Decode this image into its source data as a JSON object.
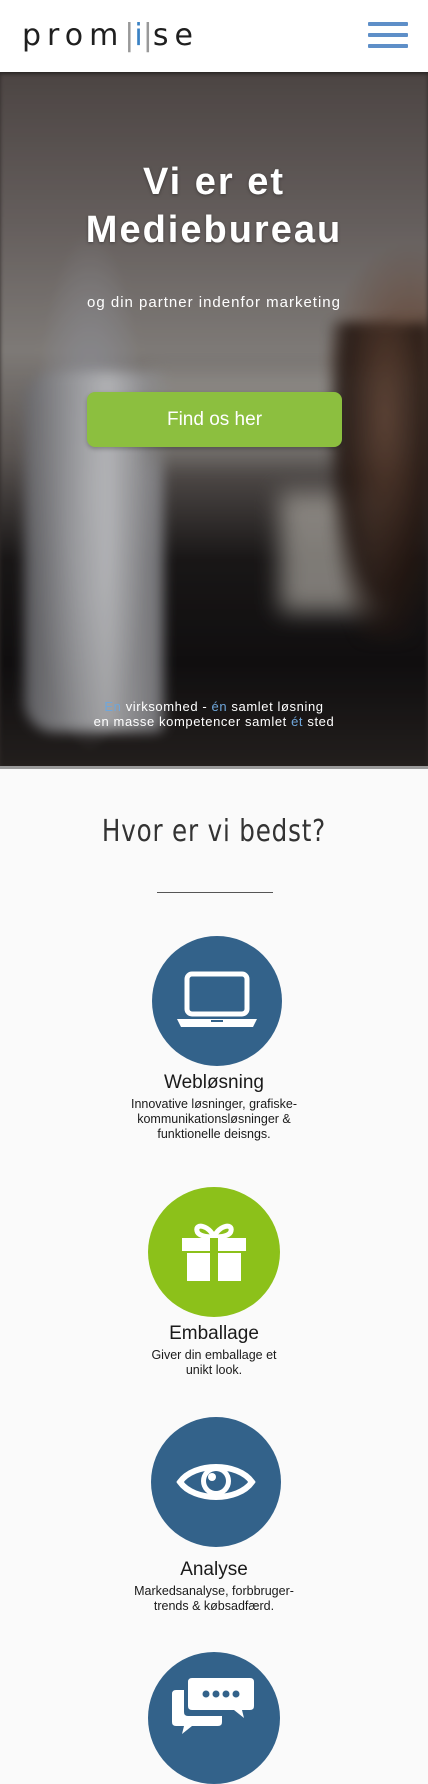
{
  "header": {
    "logo": {
      "part1": "prom",
      "bar1": "|",
      "i": "i",
      "bar2": "|",
      "part2": "se"
    },
    "menu_icon": "hamburger-menu-icon"
  },
  "hero": {
    "title_line1": "Vi er et",
    "title_line2": "Mediebureau",
    "subtitle": "og din partner indenfor marketing",
    "cta_label": "Find os her",
    "tagline": {
      "line1_a": "En",
      "line1_b": " virksomhed - ",
      "line1_c": "én",
      "line1_d": " samlet løsning",
      "line2_a": "en masse kompetencer samlet ",
      "line2_b": "ét",
      "line2_c": " sted"
    }
  },
  "section": {
    "title": "Hvor er vi bedst?"
  },
  "services": [
    {
      "name": "Webløsning",
      "desc_lines": [
        "Innovative løsninger, grafiske-",
        "kommunikationsløsninger &",
        "funktionelle deisngs."
      ],
      "icon": "laptop-icon",
      "color": "#33628a"
    },
    {
      "name": "Emballage",
      "desc_lines": [
        "Giver din emballage et",
        "unikt look."
      ],
      "icon": "gift-icon",
      "color": "#8cc11a"
    },
    {
      "name": "Analyse",
      "desc_lines": [
        "Markedsanalyse, forbbruger-",
        "trends & købsadfærd."
      ],
      "icon": "eye-icon",
      "color": "#33628a"
    },
    {
      "name": "",
      "desc_lines": [],
      "icon": "chat-bubbles-icon",
      "color": "#33628a"
    }
  ],
  "colors": {
    "accent_green": "#8cbf3f",
    "accent_blue": "#5e8fc8",
    "circle_blue": "#33628a",
    "circle_green": "#8cc11a"
  }
}
